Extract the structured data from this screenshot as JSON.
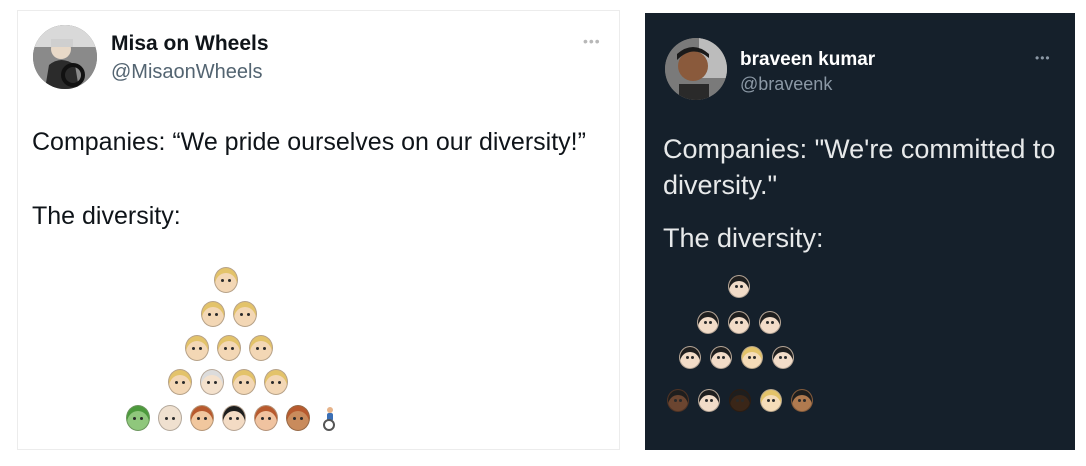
{
  "left_tweet": {
    "display_name": "Misa on Wheels",
    "handle": "@MisaonWheels",
    "more": "•••",
    "line1": "Companies: “We pride ourselves on our diversity!”",
    "line2": "The diversity:",
    "theme_bg": "#ffffff",
    "emoji_rows": [
      [
        "blond-man-face"
      ],
      [
        "blond-man-face",
        "blond-man-face"
      ],
      [
        "blond-man-face",
        "blond-man-face",
        "blond-man-face"
      ],
      [
        "blond-man-face",
        "white-haired-face",
        "blond-man-face",
        "blond-man-face"
      ],
      [
        "zombie-face",
        "bald-face",
        "blond-man-face",
        "dark-haired-woman-face",
        "red-haired-woman-face",
        "brown-haired-face",
        "wheelchair-person"
      ]
    ]
  },
  "right_tweet": {
    "display_name": "braveen kumar",
    "handle": "@braveenk",
    "more": "•••",
    "line1": "Companies: \"We're committed to diversity.\"",
    "line2": "The diversity:",
    "theme_bg": "#15202b",
    "emoji_rows": [
      [
        "mustached-man-face"
      ],
      [
        "mustached-man-face",
        "mustached-man-face",
        "mustached-man-face"
      ],
      [
        "mustached-man-face",
        "mustached-man-face",
        "blond-woman-face",
        "mustached-man-face"
      ],
      [
        "dark-skin-man-face",
        "mustached-man-face",
        "dark-skin-woman-face",
        "blond-woman-face",
        "brown-skin-woman-face"
      ]
    ]
  }
}
